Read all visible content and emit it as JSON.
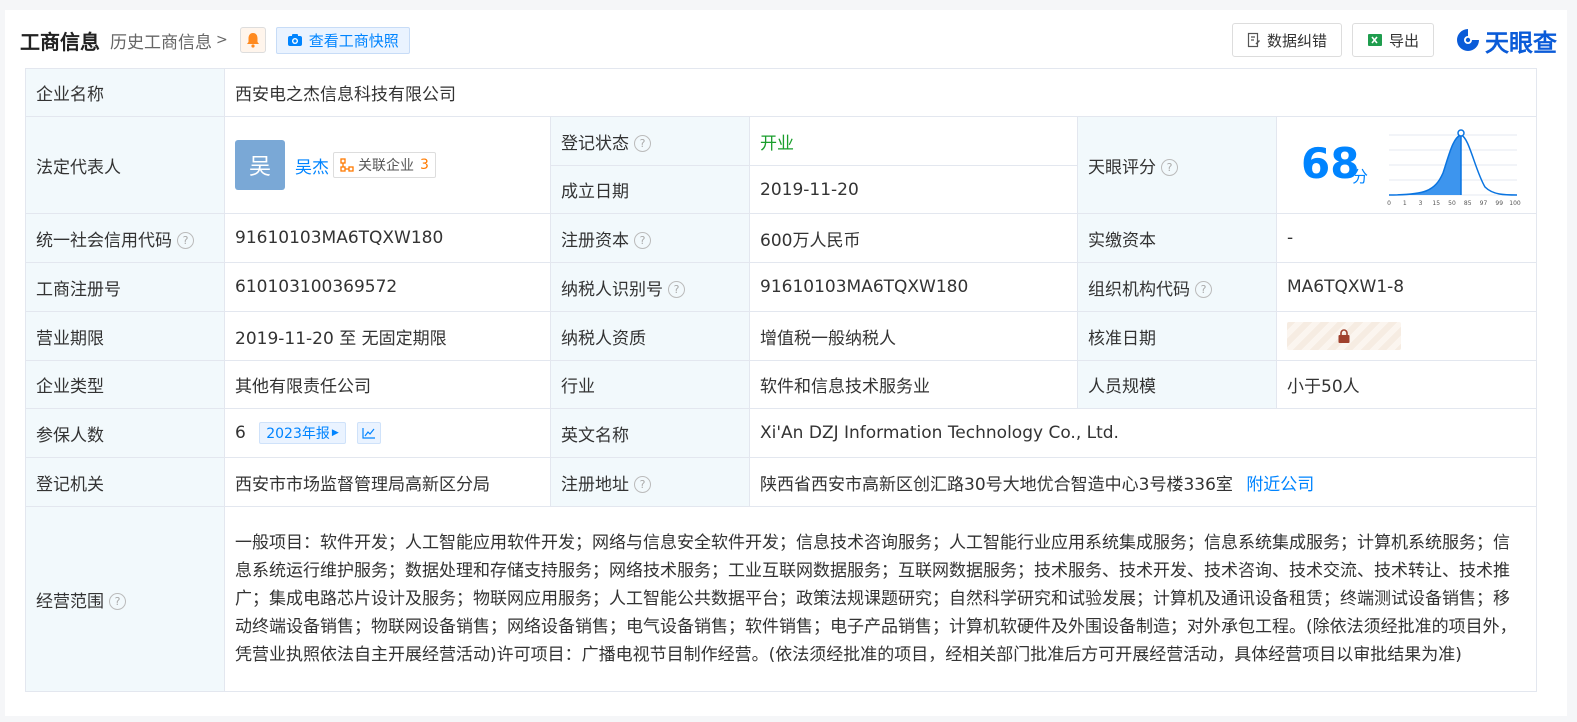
{
  "header": {
    "title": "工商信息",
    "history_label": "历史工商信息",
    "snapshot_label": "查看工商快照",
    "correct_label": "数据纠错",
    "export_label": "导出",
    "brand": "天眼查"
  },
  "labels": {
    "company_name": "企业名称",
    "legal_rep": "法定代表人",
    "reg_status": "登记状态",
    "found_date": "成立日期",
    "tianyan_score": "天眼评分",
    "credit_code": "统一社会信用代码",
    "reg_capital": "注册资本",
    "paid_capital": "实缴资本",
    "reg_number": "工商注册号",
    "taxpayer_id": "纳税人识别号",
    "org_code": "组织机构代码",
    "biz_term": "营业期限",
    "taxpayer_type": "纳税人资质",
    "approve_date": "核准日期",
    "company_type": "企业类型",
    "industry": "行业",
    "staff_size": "人员规模",
    "insured": "参保人数",
    "english_name": "英文名称",
    "reg_authority": "登记机关",
    "reg_address": "注册地址",
    "biz_scope": "经营范围"
  },
  "values": {
    "company_name": "西安电之杰信息科技有限公司",
    "legal_rep_avatar": "吴",
    "legal_rep_name": "吴杰",
    "related_label": "关联企业",
    "related_count": "3",
    "reg_status": "开业",
    "found_date": "2019-11-20",
    "score": "68",
    "score_unit": "分",
    "score_axis": [
      "0",
      "1",
      "3",
      "15",
      "50",
      "85",
      "97",
      "99",
      "100"
    ],
    "credit_code": "91610103MA6TQXW180",
    "reg_capital": "600万人民币",
    "paid_capital": "-",
    "reg_number": "610103100369572",
    "taxpayer_id": "91610103MA6TQXW180",
    "org_code": "MA6TQXW1-8",
    "biz_term": "2019-11-20 至 无固定期限",
    "taxpayer_type": "增值税一般纳税人",
    "company_type": "其他有限责任公司",
    "industry": "软件和信息技术服务业",
    "staff_size": "小于50人",
    "insured": "6",
    "insured_year": "2023年报",
    "english_name": "Xi'An DZJ Information Technology Co., Ltd.",
    "reg_authority": "西安市市场监督管理局高新区分局",
    "reg_address": "陕西省西安市高新区创汇路30号大地优合智造中心3号楼336室",
    "nearby_label": "附近公司",
    "biz_scope": "一般项目：软件开发；人工智能应用软件开发；网络与信息安全软件开发；信息技术咨询服务；人工智能行业应用系统集成服务；信息系统集成服务；计算机系统服务；信息系统运行维护服务；数据处理和存储支持服务；网络技术服务；工业互联网数据服务；互联网数据服务；技术服务、技术开发、技术咨询、技术交流、技术转让、技术推广；集成电路芯片设计及服务；物联网应用服务；人工智能公共数据平台；政策法规课题研究；自然科学研究和试验发展；计算机及通讯设备租赁；终端测试设备销售；移动终端设备销售；物联网设备销售；网络设备销售；电气设备销售；软件销售；电子产品销售；计算机软硬件及外围设备制造；对外承包工程。(除依法须经批准的项目外，凭营业执照依法自主开展经营活动)许可项目：广播电视节目制作经营。(依法须经批准的项目，经相关部门批准后方可开展经营活动，具体经营项目以审批结果为准)"
  },
  "colors": {
    "accent": "#0084ff",
    "status_green": "#1a9e2c",
    "label_bg": "#f2f9fc"
  }
}
